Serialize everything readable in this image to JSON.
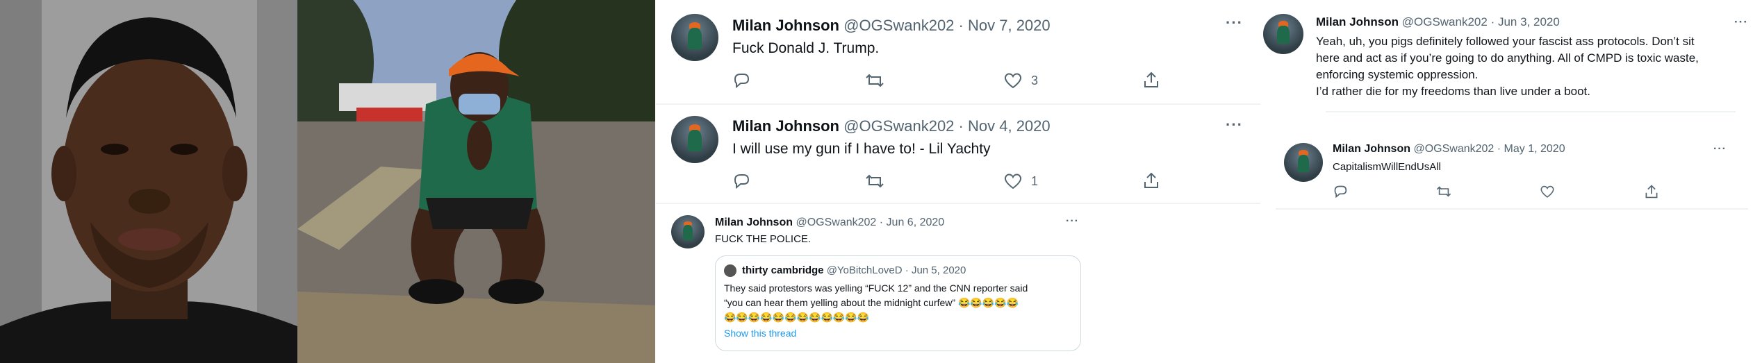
{
  "photos": {
    "mugshot": {
      "icon": "person-photo"
    },
    "street": {
      "icon": "person-crouching-photo"
    }
  },
  "tweets": [
    {
      "name": "Milan Johnson",
      "handle": "@OGSwank202",
      "sep": "·",
      "date": "Nov 7, 2020",
      "text": "Fuck Donald J. Trump.",
      "likes": "3",
      "more": "···"
    },
    {
      "name": "Milan Johnson",
      "handle": "@OGSwank202",
      "sep": "·",
      "date": "Nov 4, 2020",
      "text": "I will use my gun if I have to! - Lil Yachty",
      "likes": "1",
      "more": "···"
    },
    {
      "name": "Milan Johnson",
      "handle": "@OGSwank202",
      "sep": "·",
      "date": "Jun 6, 2020",
      "text": "FUCK THE POLICE.",
      "more": "···",
      "quote": {
        "name": "thirty cambridge",
        "handle": "@YoBitchLoveD",
        "sep": "·",
        "date": "Jun 5, 2020",
        "line1": "They said protestors was yelling “FUCK 12” and the CNN reporter said",
        "line2": "“you can hear them yelling about the midnight curfew” 😂😂😂😂😂",
        "line3": "😂😂😂😂😂😂😂😂😂😂😂😂",
        "show_thread": "Show this thread"
      }
    },
    {
      "name": "Milan Johnson",
      "handle": "@OGSwank202",
      "sep": "·",
      "date": "Jun 3, 2020",
      "line1": "Yeah, uh, you pigs definitely followed your fascist ass protocols. Don’t sit",
      "line2": "here and act as if you’re going to do anything. All of CMPD is toxic waste,",
      "line3": "enforcing systemic oppression.",
      "line4": "I’d rather die for my freedoms than live under a boot.",
      "more": "···"
    },
    {
      "name": "Milan Johnson",
      "handle": "@OGSwank202",
      "sep": "·",
      "date": "May 1, 2020",
      "text": "CapitalismWillEndUsAll",
      "more": "···"
    }
  ]
}
